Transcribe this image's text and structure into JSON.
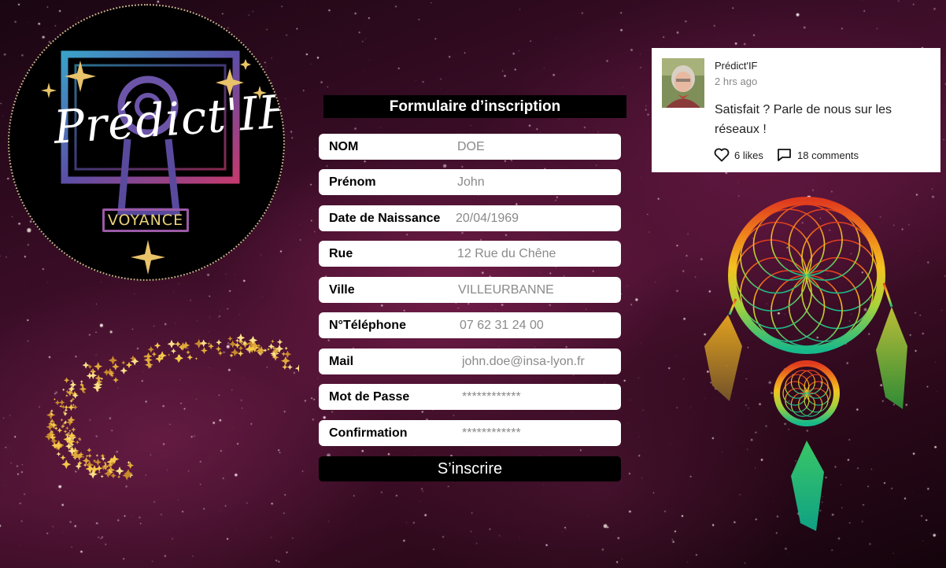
{
  "logo": {
    "title": "Prédict'IF",
    "subtitle": "VOYANCE"
  },
  "form": {
    "title": "Formulaire d’inscription",
    "fields": [
      {
        "label": "NOM",
        "value": "DOE"
      },
      {
        "label": "Prénom",
        "value": "John"
      },
      {
        "label": "Date de Naissance",
        "value": "20/04/1969"
      },
      {
        "label": "Rue",
        "value": "12 Rue du Chêne"
      },
      {
        "label": "Ville",
        "value": "VILLEURBANNE"
      },
      {
        "label": "N°Téléphone",
        "value": "07 62 31 24 00"
      },
      {
        "label": "Mail",
        "value": "john.doe@insa-lyon.fr"
      },
      {
        "label": "Mot de Passe",
        "value": "************"
      },
      {
        "label": "Confirmation",
        "value": "************"
      }
    ],
    "submit_label": "S’inscrire"
  },
  "post": {
    "author": "Prédict'IF",
    "time": "2 hrs ago",
    "text": "Satisfait ? Parle de nous sur les réseaux !",
    "likes": "6 likes",
    "comments": "18 comments",
    "like_icon": "heart-icon",
    "comment_icon": "comment-icon"
  },
  "colors": {
    "form_header_bg": "#000000",
    "field_bg": "#ffffff",
    "field_value": "#8a8a8a",
    "accent_gold": "#e8c36a"
  }
}
